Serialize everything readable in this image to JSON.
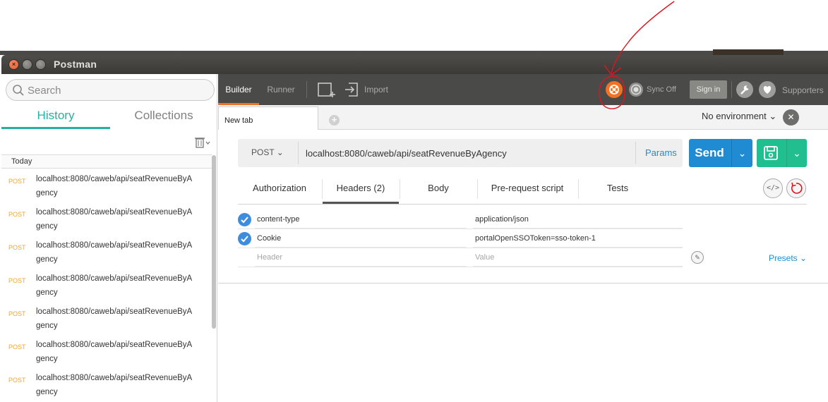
{
  "window": {
    "title": "Postman",
    "close_glyph": "×"
  },
  "sidebar": {
    "search_placeholder": "Search",
    "tabs": [
      {
        "label": "History"
      },
      {
        "label": "Collections"
      }
    ],
    "active_tab": "History",
    "group_label": "Today",
    "history": [
      {
        "method": "POST",
        "url": "localhost:8080/caweb/api/seatRevenueByAgency"
      },
      {
        "method": "POST",
        "url": "localhost:8080/caweb/api/seatRevenueByAgency"
      },
      {
        "method": "POST",
        "url": "localhost:8080/caweb/api/seatRevenueByAgency"
      },
      {
        "method": "POST",
        "url": "localhost:8080/caweb/api/seatRevenueByAgency"
      },
      {
        "method": "POST",
        "url": "localhost:8080/caweb/api/seatRevenueByAgency"
      },
      {
        "method": "POST",
        "url": "localhost:8080/caweb/api/seatRevenueByAgency"
      },
      {
        "method": "POST",
        "url": "localhost:8080/caweb/api/seatRevenueByAgency"
      }
    ]
  },
  "toolbar": {
    "builder": "Builder",
    "runner": "Runner",
    "import": "Import",
    "sync": "Sync Off",
    "signin": "Sign in",
    "supporters": "Supporters"
  },
  "tabbar": {
    "tab_label": "New tab",
    "add_glyph": "+",
    "environment": "No environment ⌄",
    "env_glyph": "✕"
  },
  "request": {
    "method": "POST ⌄",
    "url": "localhost:8080/caweb/api/seatRevenueByAgency",
    "params": "Params",
    "send": "Send",
    "caret": "⌄",
    "tabs": {
      "authorization": "Authorization",
      "headers": "Headers (2)",
      "body": "Body",
      "prerequest": "Pre-request script",
      "tests": "Tests"
    },
    "code_glyph": "</>",
    "headers": [
      {
        "key": "content-type",
        "value": "application/json",
        "enabled": true
      },
      {
        "key": "Cookie",
        "value": "portalOpenSSOToken=sso-token-1",
        "enabled": true
      }
    ],
    "header_placeholder": "Header",
    "value_placeholder": "Value",
    "presets": "Presets ⌄",
    "edit_glyph": "✎"
  },
  "colors": {
    "accent_orange": "#f47023",
    "send_blue": "#1e8bd3",
    "save_green": "#21bf8f",
    "history_teal": "#27b0a0",
    "annotation_red": "#e0141e"
  }
}
